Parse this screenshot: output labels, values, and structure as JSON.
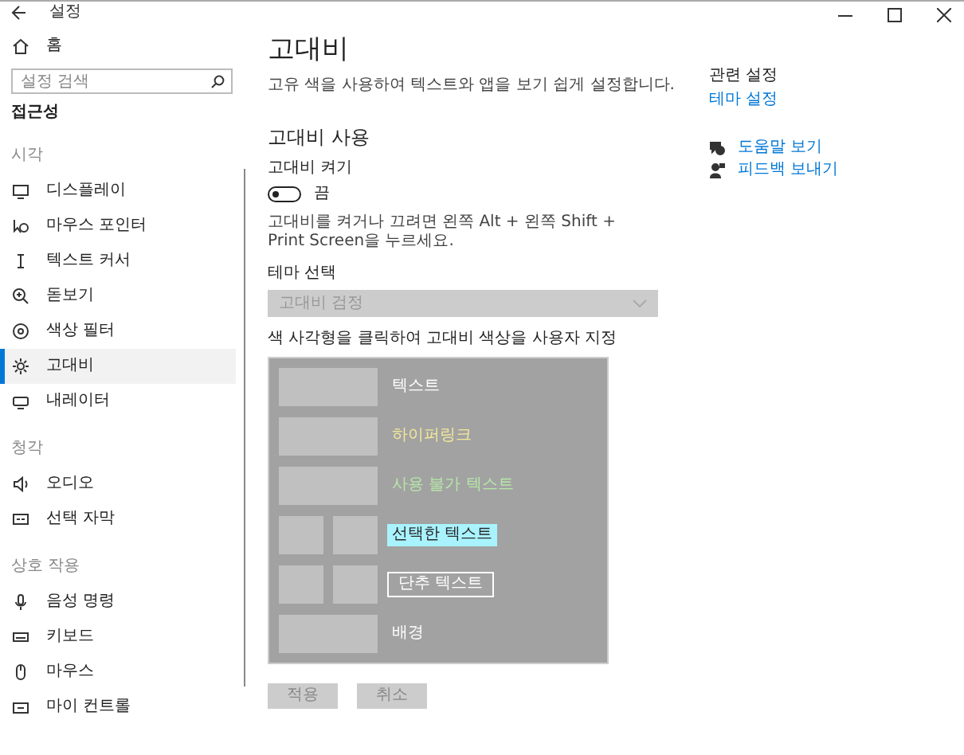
{
  "window": {
    "title": "설정"
  },
  "sidebar": {
    "home": "홈",
    "search": {
      "placeholder": "설정 검색"
    },
    "section": "접근성",
    "items": [
      {
        "kind": "header",
        "label": "시각"
      },
      {
        "kind": "item",
        "label": "디스플레이",
        "selected": false
      },
      {
        "kind": "item",
        "label": "마우스 포인터",
        "selected": false
      },
      {
        "kind": "item",
        "label": "텍스트 커서",
        "selected": false
      },
      {
        "kind": "item",
        "label": "돋보기",
        "selected": false
      },
      {
        "kind": "item",
        "label": "색상 필터",
        "selected": false
      },
      {
        "kind": "item",
        "label": "고대비",
        "selected": true
      },
      {
        "kind": "item",
        "label": "내레이터",
        "selected": false
      },
      {
        "kind": "header",
        "label": "청각"
      },
      {
        "kind": "item",
        "label": "오디오",
        "selected": false
      },
      {
        "kind": "item",
        "label": "선택 자막",
        "selected": false
      },
      {
        "kind": "header",
        "label": "상호 작용"
      },
      {
        "kind": "item",
        "label": "음성 명령",
        "selected": false
      },
      {
        "kind": "item",
        "label": "키보드",
        "selected": false
      },
      {
        "kind": "item",
        "label": "마우스",
        "selected": false
      },
      {
        "kind": "item",
        "label": "마이 컨트롤",
        "selected": false
      }
    ]
  },
  "main": {
    "title": "고대비",
    "description": "고유 색을 사용하여 텍스트와 앱을 보기 쉽게 설정합니다.",
    "section": "고대비 사용",
    "toggle": {
      "label": "고대비 켜기",
      "on": false,
      "state_text": "끔"
    },
    "hint": "고대비를 켜거나 끄려면 왼쪽 Alt + 왼쪽 Shift + Print Screen을 누르세요.",
    "theme": {
      "label": "테마 선택",
      "value": "고대비 검정",
      "disabled": true
    },
    "colors": {
      "label": "색 사각형을 클릭하여 고대비 색상을 사용자 지정",
      "rows": [
        {
          "kind": "text",
          "label": "텍스트"
        },
        {
          "kind": "hyperlink",
          "label": "하이퍼링크"
        },
        {
          "kind": "disabled",
          "label": "사용 불가 텍스트"
        },
        {
          "kind": "selected",
          "label": "선택한 텍스트"
        },
        {
          "kind": "button",
          "label": "단추 텍스트"
        },
        {
          "kind": "background",
          "label": "배경"
        }
      ]
    },
    "buttons": [
      {
        "label": "적용",
        "disabled": true
      },
      {
        "label": "취소",
        "disabled": true
      }
    ]
  },
  "related": {
    "title": "관련 설정",
    "links": [
      "테마 설정"
    ],
    "help": [
      {
        "kind": "help",
        "label": "도움말 보기"
      },
      {
        "kind": "feedback",
        "label": "피드백 보내기"
      }
    ]
  }
}
